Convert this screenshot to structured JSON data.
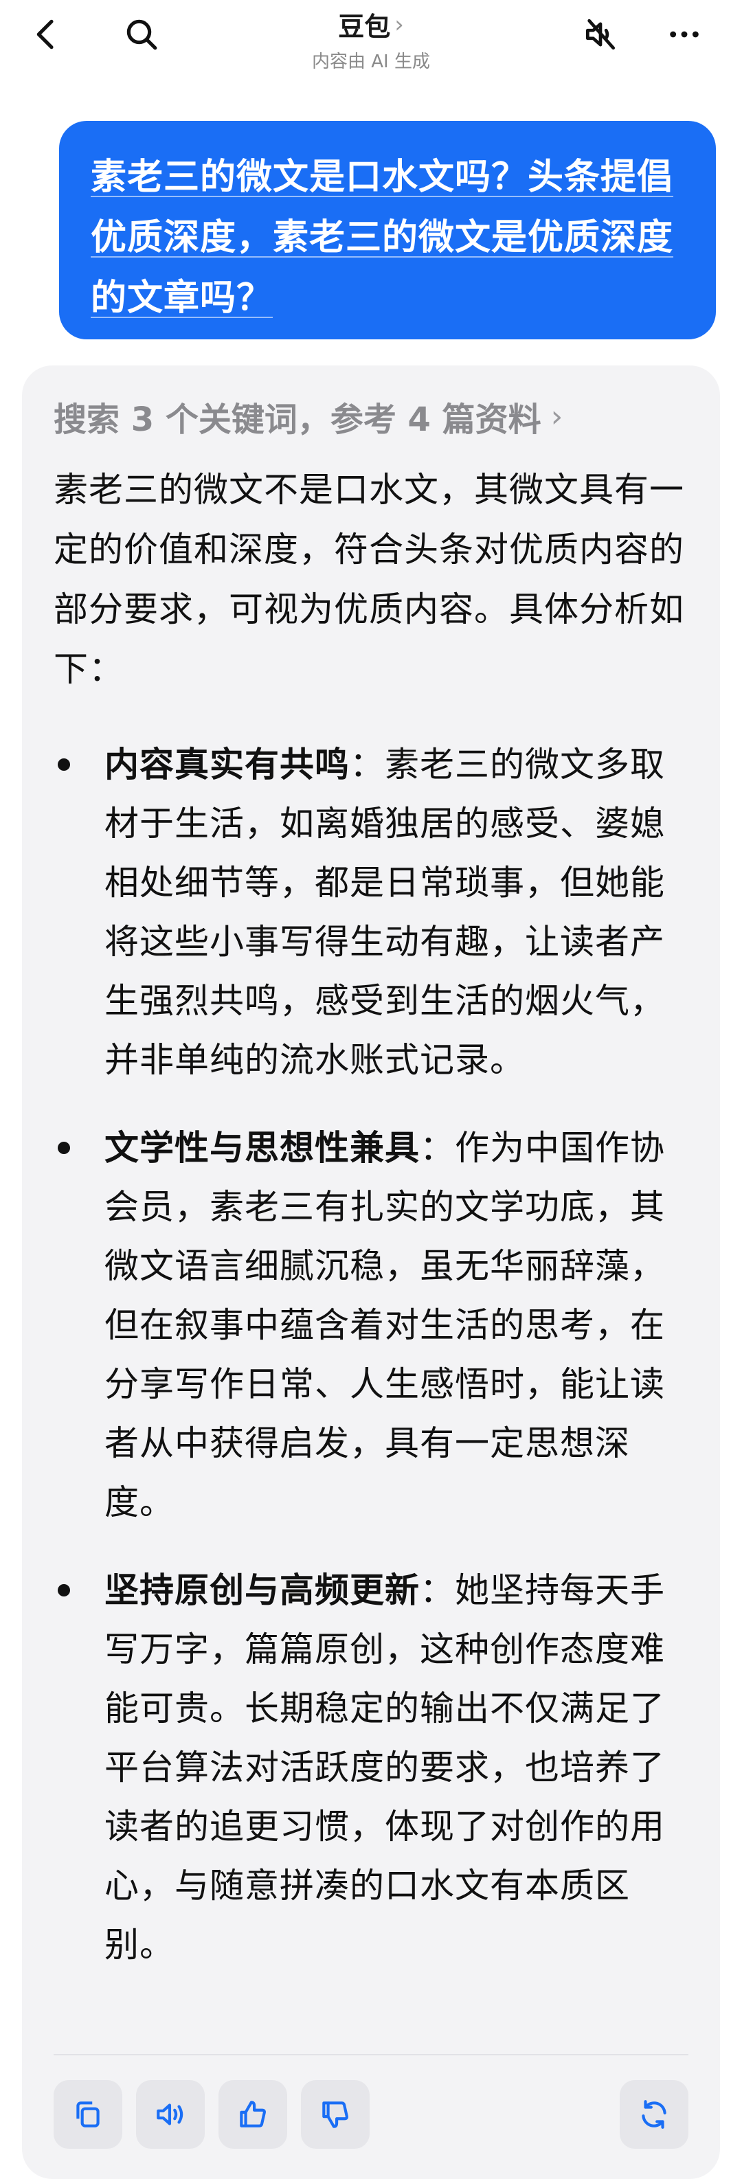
{
  "header": {
    "title": "豆包",
    "subtitle": "内容由 AI 生成",
    "icons": {
      "back": "back-arrow-icon",
      "search": "search-icon",
      "mute": "mute-speaker-icon",
      "more": "more-dots-icon"
    }
  },
  "user_message": {
    "text": "素老三的微文是口水文吗？头条提倡优质深度，素老三的微文是优质深度的文章吗？"
  },
  "answer": {
    "search_summary": "搜索 3 个关键词，参考 4 篇资料",
    "intro": "素老三的微文不是口水文，其微文具有一定的价值和深度，符合头条对优质内容的部分要求，可视为优质内容。具体分析如下：",
    "bullets": [
      {
        "title": "内容真实有共鸣",
        "body": "：素老三的微文多取材于生活，如离婚独居的感受、婆媳相处细节等，都是日常琐事，但她能将这些小事写得生动有趣，让读者产生强烈共鸣，感受到生活的烟火气，并非单纯的流水账式记录。"
      },
      {
        "title": "文学性与思想性兼具",
        "body": "：作为中国作协会员，素老三有扎实的文学功底，其微文语言细腻沉稳，虽无华丽辞藻，但在叙事中蕴含着对生活的思考，在分享写作日常、人生感悟时，能让读者从中获得启发，具有一定思想深度。"
      },
      {
        "title": "坚持原创与高频更新",
        "body": "：她坚持每天手写万字，篇篇原创，这种创作态度难能可贵。长期稳定的输出不仅满足了平台算法对活跃度的要求，也培养了读者的追更习惯，体现了对创作的用心，与随意拼凑的口水文有本质区别。"
      }
    ],
    "actions": {
      "copy": "copy-icon",
      "speak": "speaker-icon",
      "like": "thumbs-up-icon",
      "dislike": "thumbs-down-icon",
      "regenerate": "regenerate-icon"
    }
  },
  "colors": {
    "accent": "#1a6ef5",
    "card_bg": "#f3f3f5",
    "muted_text": "#8a8a8e"
  }
}
